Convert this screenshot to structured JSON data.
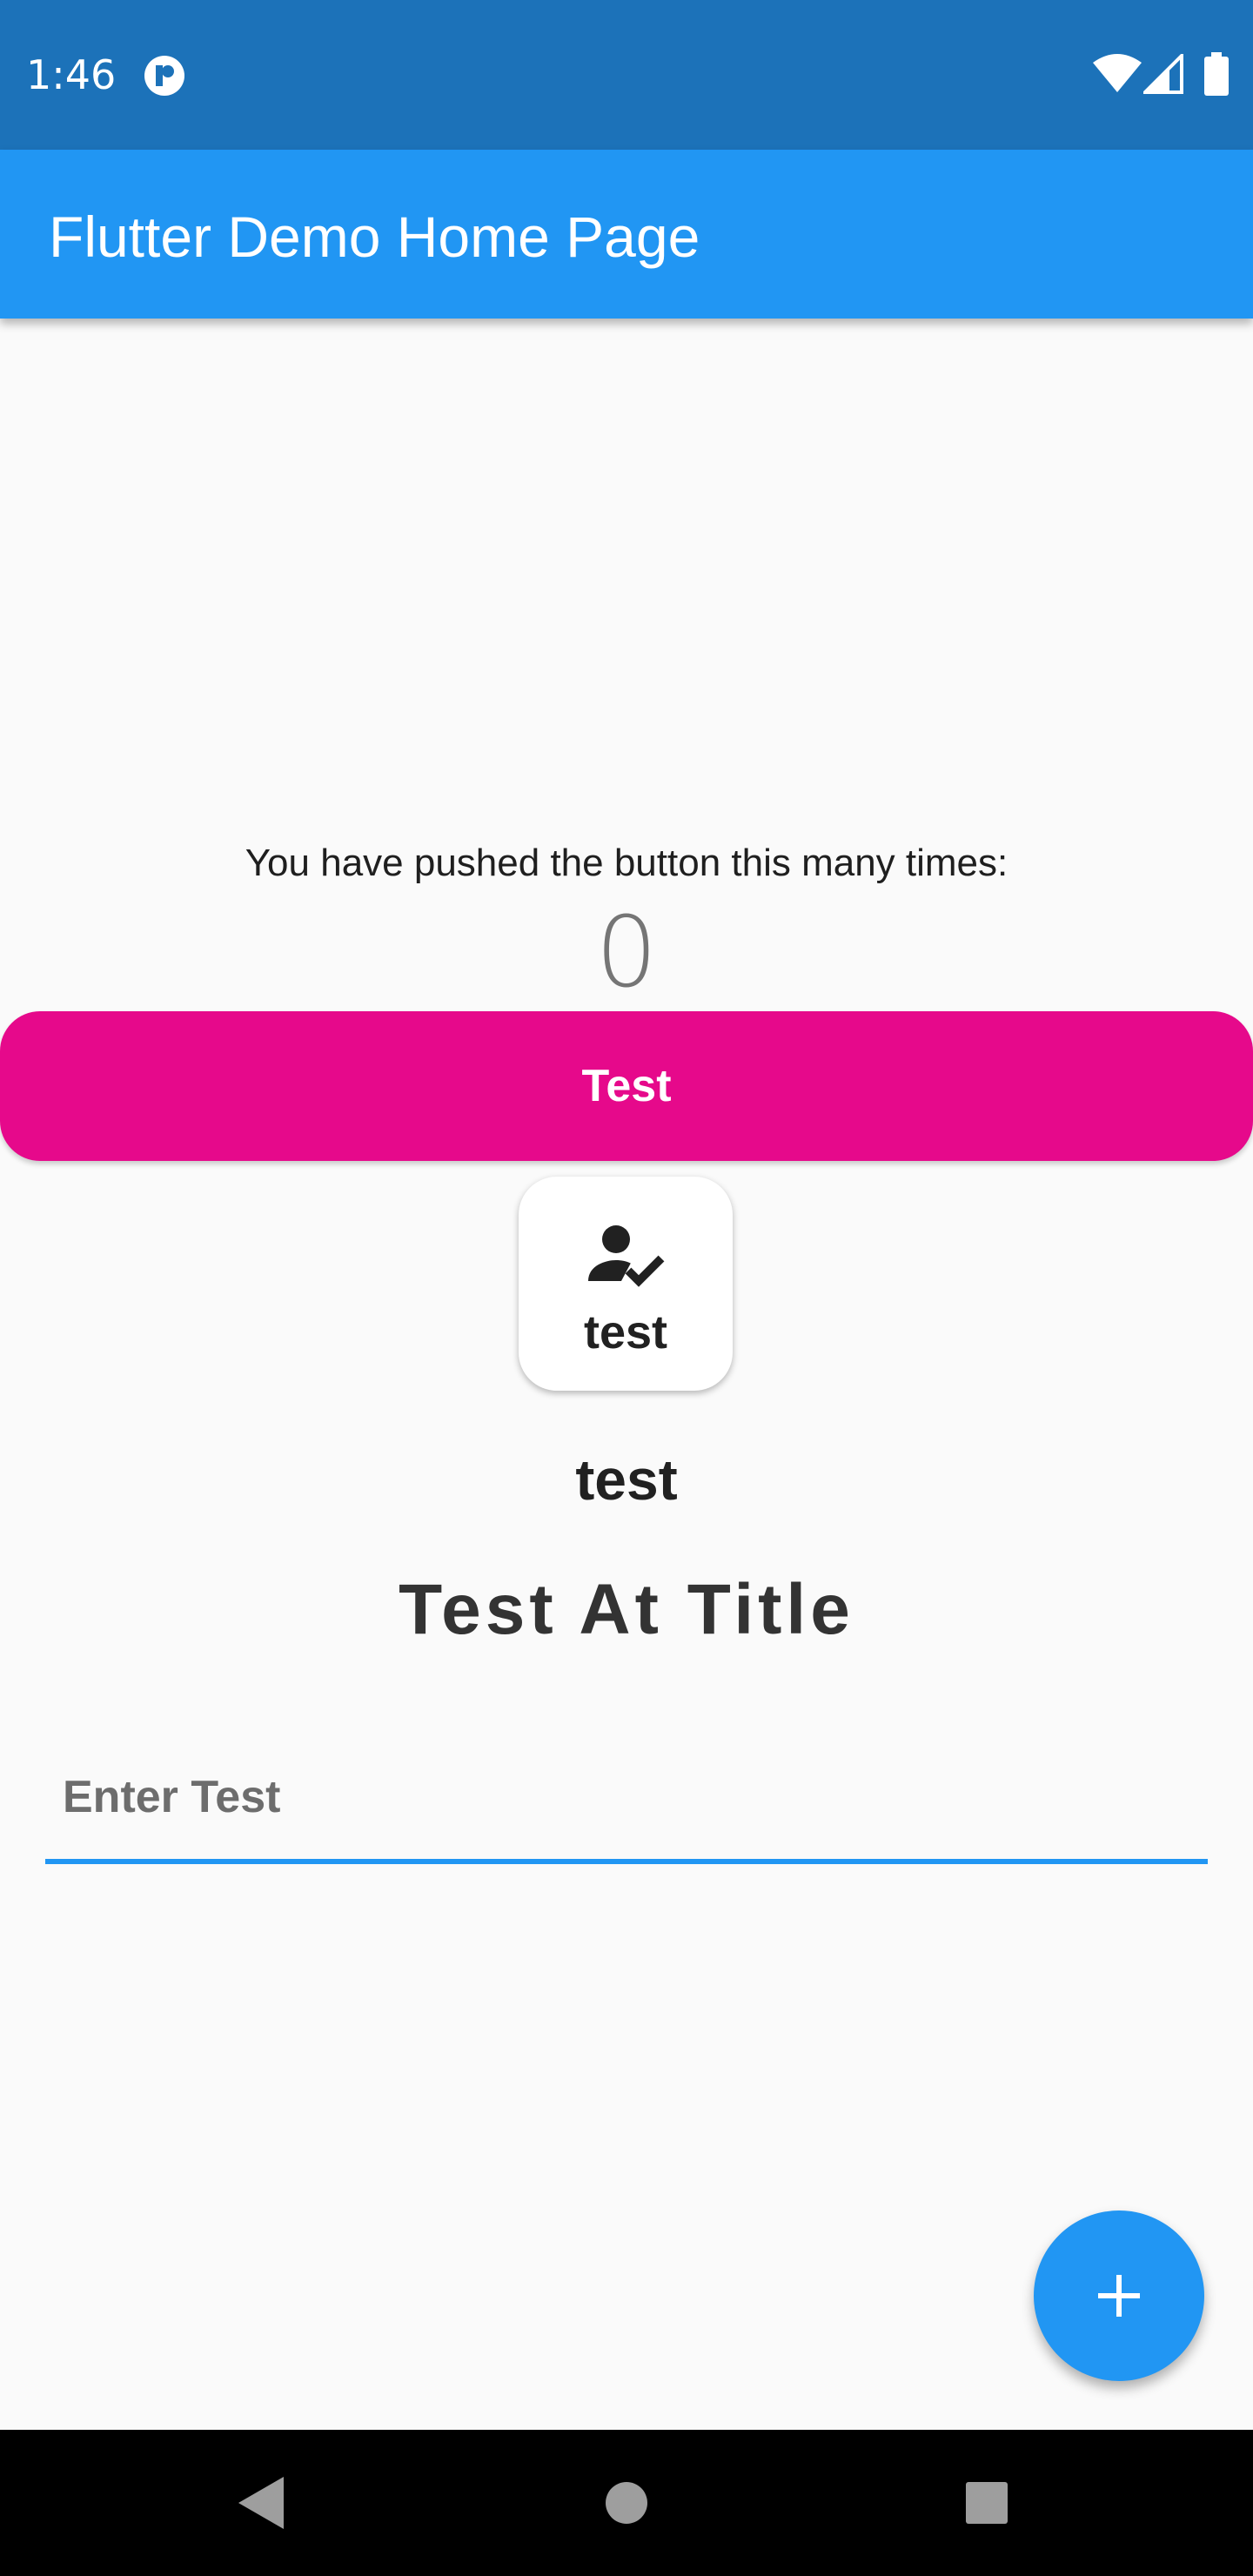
{
  "status_bar": {
    "time": "1:46",
    "icons": [
      "app-notification-icon",
      "wifi-icon",
      "cell-signal-icon",
      "battery-icon"
    ]
  },
  "app_bar": {
    "title": "Flutter Demo Home Page"
  },
  "counter": {
    "label": "You have pushed the button this many times:",
    "value": "0"
  },
  "test_button": {
    "label": "Test"
  },
  "icon_card": {
    "icon": "person-check-icon",
    "label": "test"
  },
  "plain_text": "test",
  "title_text": "Test At Title",
  "text_field": {
    "placeholder": "Enter Test",
    "value": ""
  },
  "fab": {
    "icon": "plus-icon"
  },
  "nav_bar": {
    "icons": [
      "back-icon",
      "home-icon",
      "recents-icon"
    ]
  },
  "colors": {
    "status_bar": "#1c72b9",
    "app_bar": "#2196f3",
    "test_button": "#e6098b",
    "fab": "#2196f3",
    "field_underline": "#2196f3",
    "background": "#fafafa"
  }
}
